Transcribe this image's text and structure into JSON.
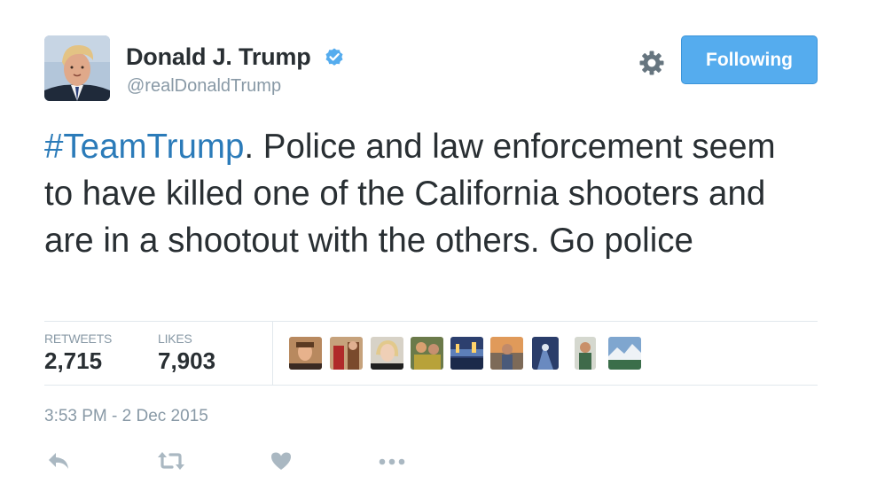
{
  "user": {
    "display_name": "Donald J. Trump",
    "screen_name": "@realDonaldTrump",
    "verified": true
  },
  "header": {
    "follow_button_label": "Following"
  },
  "tweet": {
    "hashtag": "#TeamTrump",
    "text": ". Police and law enforcement seem to have killed one of the California shooters and are in a shootout with the others. Go police",
    "timestamp": "3:53 PM - 2 Dec 2015"
  },
  "stats": {
    "retweets_label": "RETWEETS",
    "retweets_value": "2,715",
    "likes_label": "LIKES",
    "likes_value": "7,903"
  },
  "likers_count_shown": 9,
  "actions": [
    "reply-icon",
    "retweet-icon",
    "like-icon",
    "more-icon"
  ],
  "colors": {
    "follow_button_bg": "#55acee",
    "hashtag": "#2b7bb9",
    "verified_badge": "#55acee",
    "text": "#292f33",
    "secondary_text": "#8899a6",
    "divider": "#e1e8ed",
    "action_icon": "#aab8c2"
  }
}
